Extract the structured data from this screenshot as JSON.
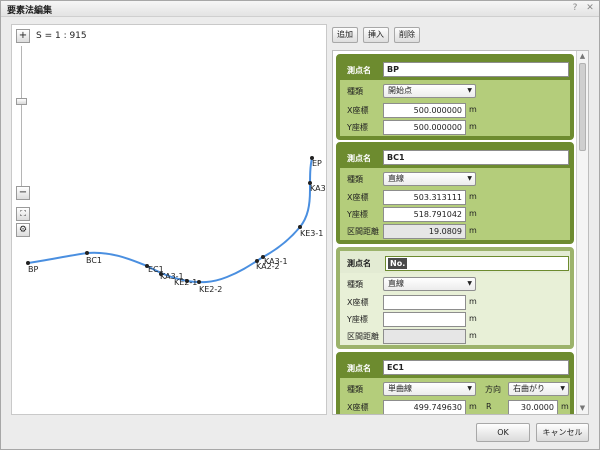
{
  "window": {
    "title": "要素法編集",
    "help": "?",
    "close": "✕"
  },
  "map": {
    "scale": "S = 1 : 915",
    "zoom_in": "+",
    "zoom_out": "−",
    "fit": "⛶",
    "settings": "⚙",
    "labels": [
      "BP",
      "BC1",
      "EC1",
      "KA3-1",
      "KE2-1",
      "KE2-2",
      "KA2-2",
      "KA3-1",
      "KE3-1",
      "KA3",
      "EP"
    ],
    "route_color": "#4a8fe0"
  },
  "toolbar": {
    "add": "追加",
    "insert": "挿入",
    "delete": "削除"
  },
  "cards": [
    {
      "name_label": "測点名",
      "name": "BP",
      "type_label": "種類",
      "type": "開始点",
      "x_label": "X座標",
      "x": "500.000000",
      "x_unit": "m",
      "y_label": "Y座標",
      "y": "500.000000",
      "y_unit": "m"
    },
    {
      "name_label": "測点名",
      "name": "BC1",
      "type_label": "種類",
      "type": "直線",
      "x_label": "X座標",
      "x": "503.313111",
      "x_unit": "m",
      "y_label": "Y座標",
      "y": "518.791042",
      "y_unit": "m",
      "dist_label": "区間距離",
      "dist": "19.0809",
      "dist_unit": "m"
    },
    {
      "name_label": "測点名",
      "name": "No.",
      "type_label": "種類",
      "type": "直線",
      "x_label": "X座標",
      "x": "",
      "x_unit": "m",
      "y_label": "Y座標",
      "y": "",
      "y_unit": "m",
      "dist_label": "区間距離",
      "dist": "",
      "dist_unit": "m"
    },
    {
      "name_label": "測点名",
      "name": "EC1",
      "type_label": "種類",
      "type": "単曲線",
      "direction_label": "方向",
      "direction": "右曲がり",
      "x_label": "X座標",
      "x": "499.749630",
      "x_unit": "m",
      "r_label": "R",
      "r": "30.0000",
      "r_unit": "m"
    }
  ],
  "footer": {
    "ok": "OK",
    "cancel": "キャンセル"
  }
}
